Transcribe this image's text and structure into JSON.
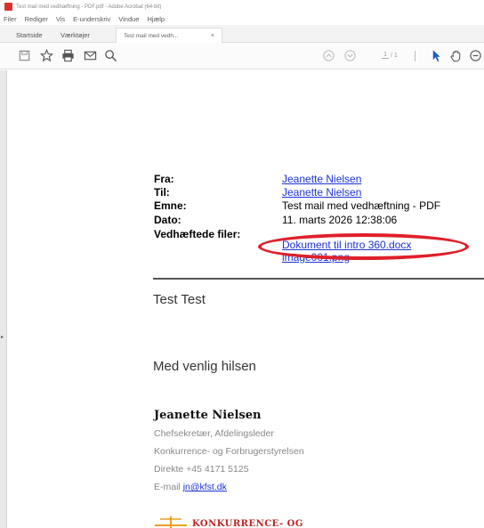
{
  "window": {
    "title": "Test mail med vedhæftning - PDF.pdf - Adobe Acrobat (64-bit)"
  },
  "menu": [
    "Filer",
    "Rediger",
    "Vis",
    "E-underskriv",
    "Vindue",
    "Hjælp"
  ],
  "tabs": {
    "home": "Startside",
    "tools": "Værktøjer",
    "document": "Test mail med vedh...",
    "close": "×"
  },
  "toolbar": {
    "icons": [
      "save-icon",
      "bookmark-star-icon",
      "print-icon",
      "email-icon",
      "search-icon",
      "page-up-icon",
      "page-down-icon",
      "select-cursor-icon",
      "hand-tool-icon",
      "zoom-out-icon"
    ],
    "page_current": "1",
    "page_total": "/ 1"
  },
  "email": {
    "from_label": "Fra:",
    "from_value": "Jeanette Nielsen",
    "to_label": "Til:",
    "to_value": "Jeanette Nielsen",
    "subject_label": "Emne:",
    "subject_value": "Test mail med vedhæftning - PDF",
    "date_label": "Dato:",
    "date_value": "11. marts 2026 12:38:06",
    "attachments_label": "Vedhæftede filer:",
    "attachments": [
      "Dokument til intro 360.docx",
      "image001.png"
    ]
  },
  "body": {
    "line1": "Test Test",
    "greeting": "Med venlig hilsen"
  },
  "signature": {
    "name": "Jeanette Nielsen",
    "title": "Chefsekretær, Afdelingsleder",
    "org": "Konkurrence- og Forbrugerstyrelsen",
    "phone": "Direkte +45 4171 5125",
    "email_prefix": "E-mail",
    "email": "jn@kfst.dk",
    "logo_text": "KONKURRENCE- OG"
  },
  "colors": {
    "link": "#1a32d6",
    "highlight": "#e0202a",
    "acrobat_red": "#d9302e"
  }
}
